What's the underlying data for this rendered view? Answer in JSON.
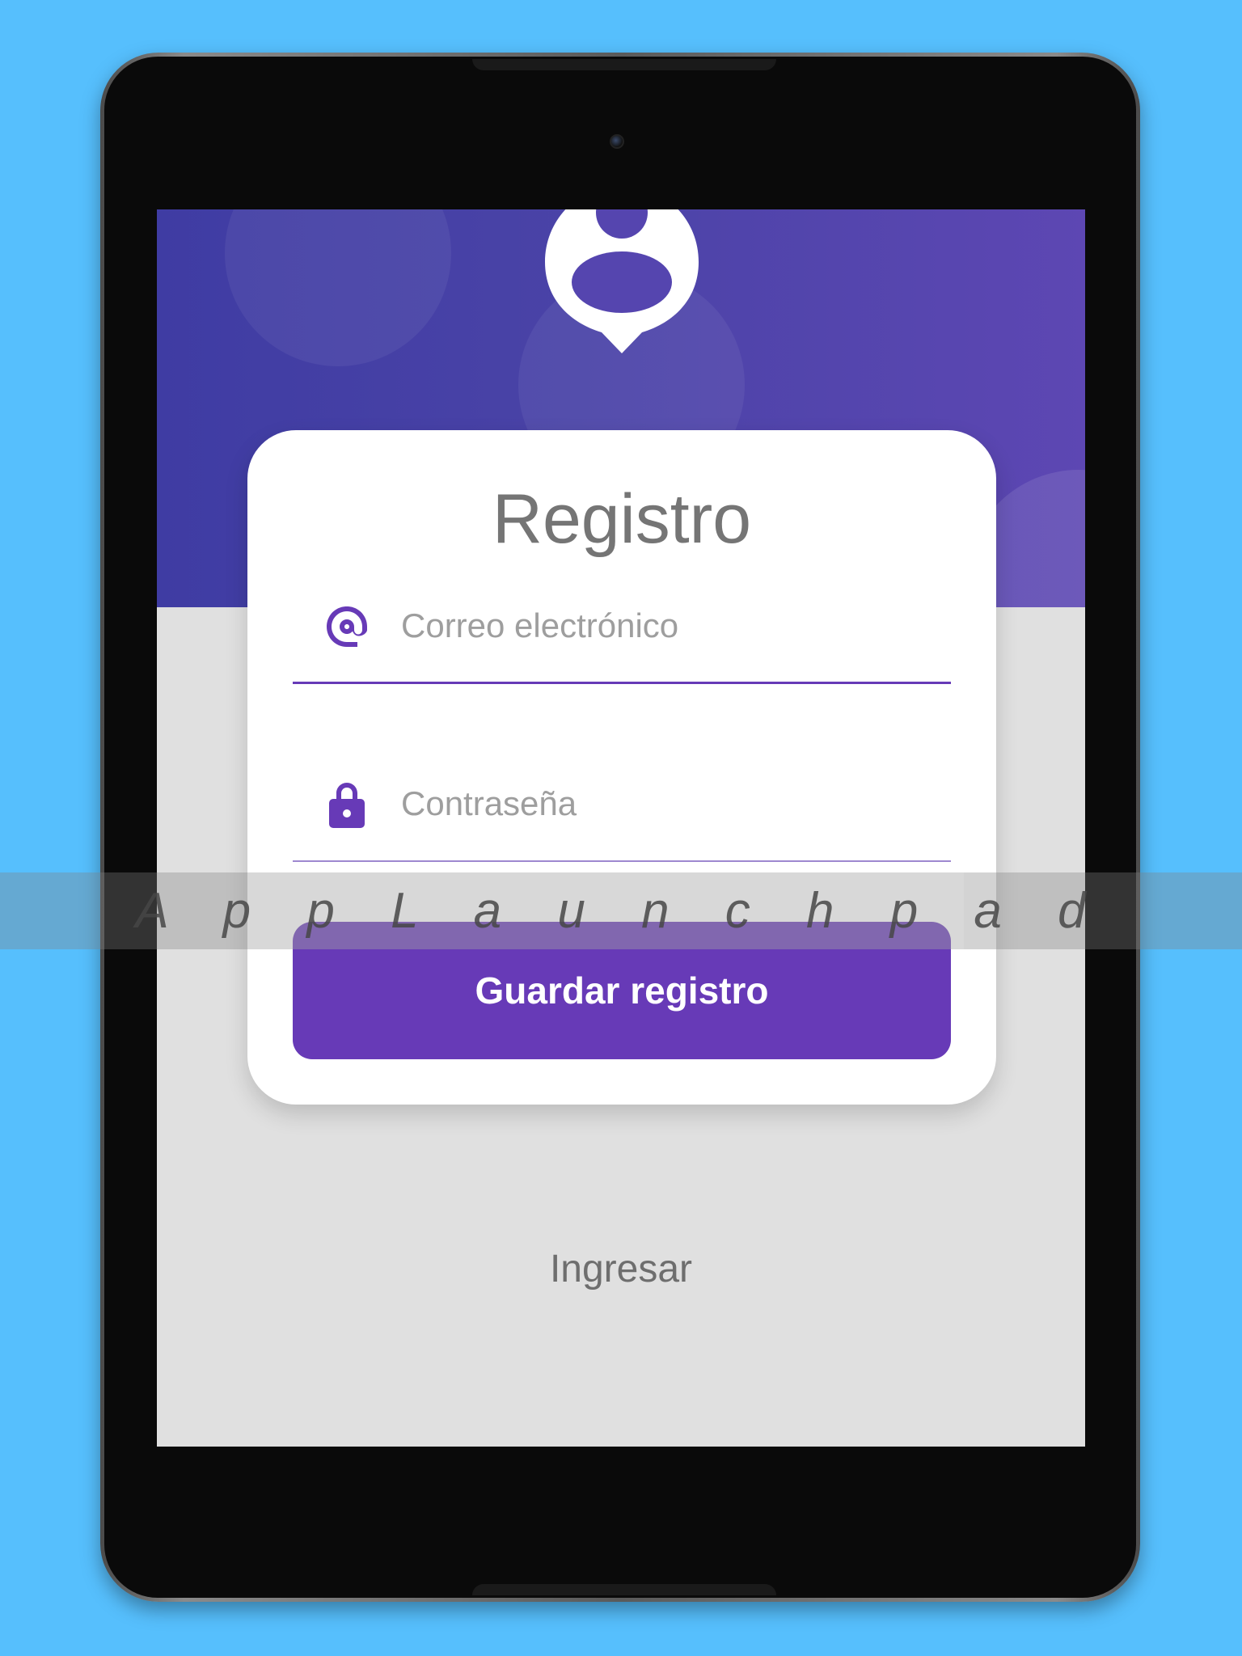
{
  "watermark": {
    "text": "A p p L a u n c h p a d"
  },
  "register": {
    "title": "Registro",
    "email": {
      "placeholder": "Correo electrónico",
      "value": "",
      "icon": "at-icon"
    },
    "password": {
      "placeholder": "Contraseña",
      "value": "",
      "icon": "lock-icon"
    },
    "save_button_label": "Guardar registro",
    "login_link_label": "Ingresar"
  },
  "colors": {
    "background": "#56BFFD",
    "hero_start": "#3F3CA3",
    "hero_end": "#5D47B3",
    "accent": "#673AB7",
    "screen_bg": "#E0E0E0",
    "card_bg": "#FFFFFF",
    "title_text": "#757575",
    "placeholder_text": "#9E9E9E"
  }
}
